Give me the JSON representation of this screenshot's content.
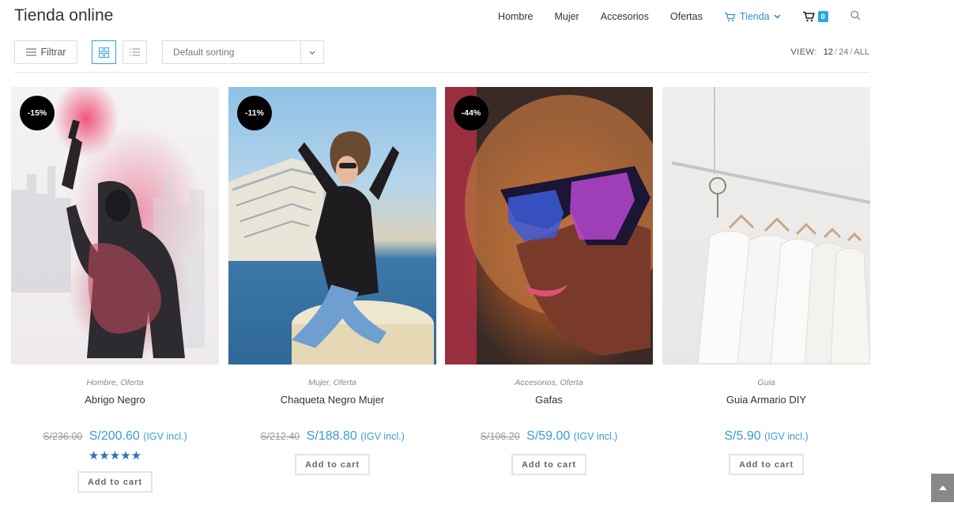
{
  "header": {
    "site_title": "Tienda online",
    "nav": [
      {
        "label": "Hombre"
      },
      {
        "label": "Mujer"
      },
      {
        "label": "Accesorios"
      },
      {
        "label": "Ofertas"
      }
    ],
    "active_nav": {
      "label": "Tienda",
      "icon": "cart-icon"
    },
    "cart_count": "0",
    "accent_color": "#3a8fc5"
  },
  "toolbar": {
    "filter_label": "Filtrar",
    "sort_selected": "Default sorting",
    "view_label": "VIEW:",
    "view_options": [
      "12",
      "24",
      "ALL"
    ],
    "view_current": "12"
  },
  "products": [
    {
      "badge": "-15%",
      "categories": "Hombre, Oferta",
      "title": "Abrigo Negro",
      "old_price": "S/236.00",
      "price": "S/200.60",
      "tax": "(IGV incl.)",
      "rating": 5,
      "stars": "★★★★★",
      "button": "Add to cart"
    },
    {
      "badge": "-11%",
      "categories": "Mujer, Oferta",
      "title": "Chaqueta Negro Mujer",
      "old_price": "S/212.40",
      "price": "S/188.80",
      "tax": "(IGV incl.)",
      "button": "Add to cart"
    },
    {
      "badge": "-44%",
      "categories": "Accesorios, Oferta",
      "title": "Gafas",
      "old_price": "S/106.20",
      "price": "S/59.00",
      "tax": "(IGV incl.)",
      "button": "Add to cart"
    },
    {
      "categories": "Guia",
      "title": "Guia Armario DIY",
      "price": "S/5.90",
      "tax": "(IGV incl.)",
      "button": "Add to cart"
    }
  ]
}
